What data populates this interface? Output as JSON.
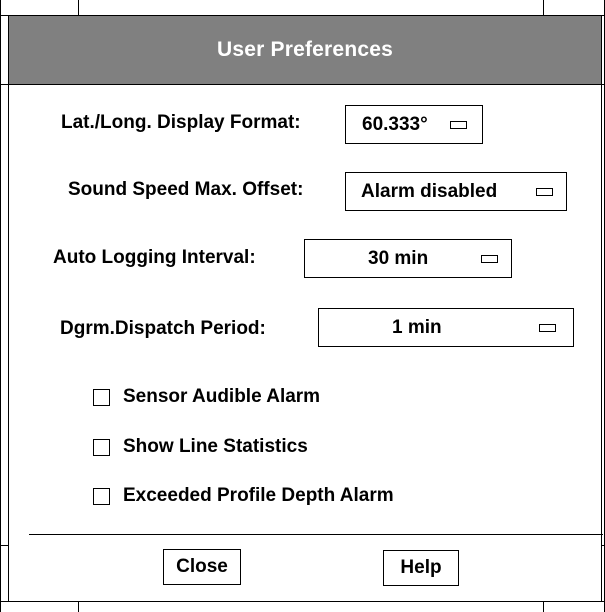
{
  "window": {
    "title": "User Preferences"
  },
  "fields": [
    {
      "label": "Lat./Long. Display Format:",
      "value": "60.333°"
    },
    {
      "label": "Sound Speed Max. Offset:",
      "value": "Alarm disabled"
    },
    {
      "label": "Auto Logging Interval:",
      "value": "30 min"
    },
    {
      "label": "Dgrm.Dispatch Period:",
      "value": "1 min"
    }
  ],
  "checkboxes": [
    {
      "label": "Sensor Audible Alarm",
      "checked": false
    },
    {
      "label": "Show Line Statistics",
      "checked": false
    },
    {
      "label": "Exceeded Profile Depth Alarm",
      "checked": false
    }
  ],
  "buttons": {
    "close": "Close",
    "help": "Help"
  }
}
